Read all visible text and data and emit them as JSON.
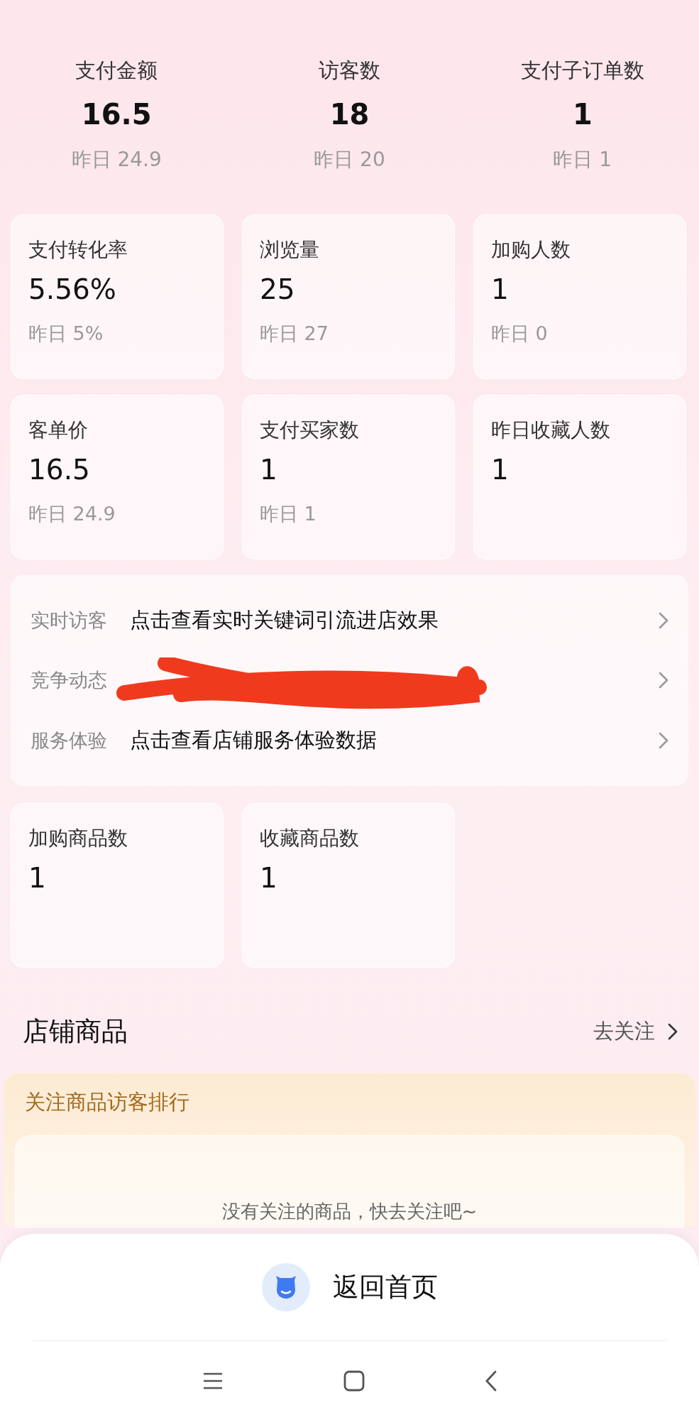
{
  "summary": [
    {
      "label": "支付金额",
      "value": "16.5",
      "yesterday": "昨日 24.9"
    },
    {
      "label": "访客数",
      "value": "18",
      "yesterday": "昨日 20"
    },
    {
      "label": "支付子订单数",
      "value": "1",
      "yesterday": "昨日 1"
    }
  ],
  "metric_cards": [
    {
      "label": "支付转化率",
      "value": "5.56%",
      "yesterday": "昨日 5%"
    },
    {
      "label": "浏览量",
      "value": "25",
      "yesterday": "昨日 27"
    },
    {
      "label": "加购人数",
      "value": "1",
      "yesterday": "昨日 0"
    },
    {
      "label": "客单价",
      "value": "16.5",
      "yesterday": "昨日 24.9"
    },
    {
      "label": "支付买家数",
      "value": "1",
      "yesterday": "昨日 1"
    },
    {
      "label": "昨日收藏人数",
      "value": "1"
    }
  ],
  "links": [
    {
      "label": "实时访客",
      "text": "点击查看实时关键词引流进店效果",
      "redacted": false
    },
    {
      "label": "竞争动态",
      "redacted": true
    },
    {
      "label": "服务体验",
      "text": "点击查看店铺服务体验数据",
      "redacted": false
    }
  ],
  "product_cards": [
    {
      "label": "加购商品数",
      "value": "1"
    },
    {
      "label": "收藏商品数",
      "value": "1"
    }
  ],
  "store_products": {
    "title": "店铺商品",
    "action": "去关注",
    "panel_title": "关注商品访客排行",
    "empty_text": "没有关注的商品，快去关注吧~"
  },
  "bottom_sheet": {
    "button": "返回首页"
  }
}
